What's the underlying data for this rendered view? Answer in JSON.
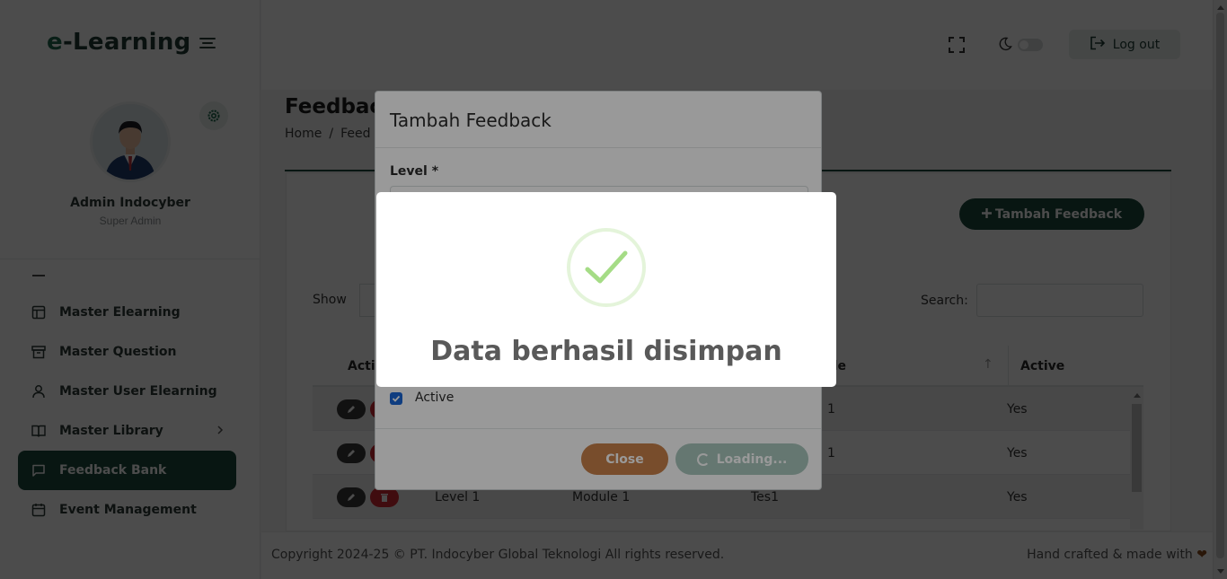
{
  "app": {
    "logo_text": "-Learning",
    "logo_e": "e"
  },
  "sidebar": {
    "user_name": "Admin Indocyber",
    "user_role": "Super Admin",
    "items": [
      {
        "label": "Master Elearning",
        "icon": "layout-icon"
      },
      {
        "label": "Master Question",
        "icon": "archive-icon"
      },
      {
        "label": "Master User Elearning",
        "icon": "user-icon"
      },
      {
        "label": "Master Library",
        "icon": "book-icon",
        "has_chevron": true
      },
      {
        "label": "Feedback Bank",
        "icon": "message-icon",
        "active": true
      },
      {
        "label": "Event Management",
        "icon": "calendar-icon"
      }
    ]
  },
  "topbar": {
    "logout_label": "Log out"
  },
  "page": {
    "title": "Feedback",
    "breadcrumb_home": "Home",
    "breadcrumb_sep": "/",
    "breadcrumb_current": "Feed",
    "add_button": "Tambah Feedback",
    "show_label": "Show",
    "search_label": "Search:"
  },
  "table": {
    "headers": {
      "action": "Acti",
      "title": "tle",
      "active": "Active"
    },
    "rows": [
      {
        "level": "",
        "module": "",
        "title": "1",
        "active": "Yes"
      },
      {
        "level": "",
        "module": "",
        "title": "1",
        "active": "Yes"
      },
      {
        "level": "Level 1",
        "module": "Module 1",
        "title": "Tes1",
        "active": "Yes"
      }
    ]
  },
  "footer": {
    "copyright": "Copyright 2024-25 © PT. Indocyber Global Teknologi All rights reserved.",
    "made_with": "Hand crafted & made with",
    "heart": "❤"
  },
  "modal": {
    "title": "Tambah Feedback",
    "level_label": "Level *",
    "active_label": "Active",
    "active_checked": true,
    "close_label": "Close",
    "loading_label": "Loading..."
  },
  "alert": {
    "title": "Data berhasil disimpan",
    "icon": "success-check-icon"
  },
  "colors": {
    "primary": "#1c4a3d",
    "close_button": "#c9814a",
    "delete_button": "#d92833",
    "success": "#a5dc86"
  }
}
